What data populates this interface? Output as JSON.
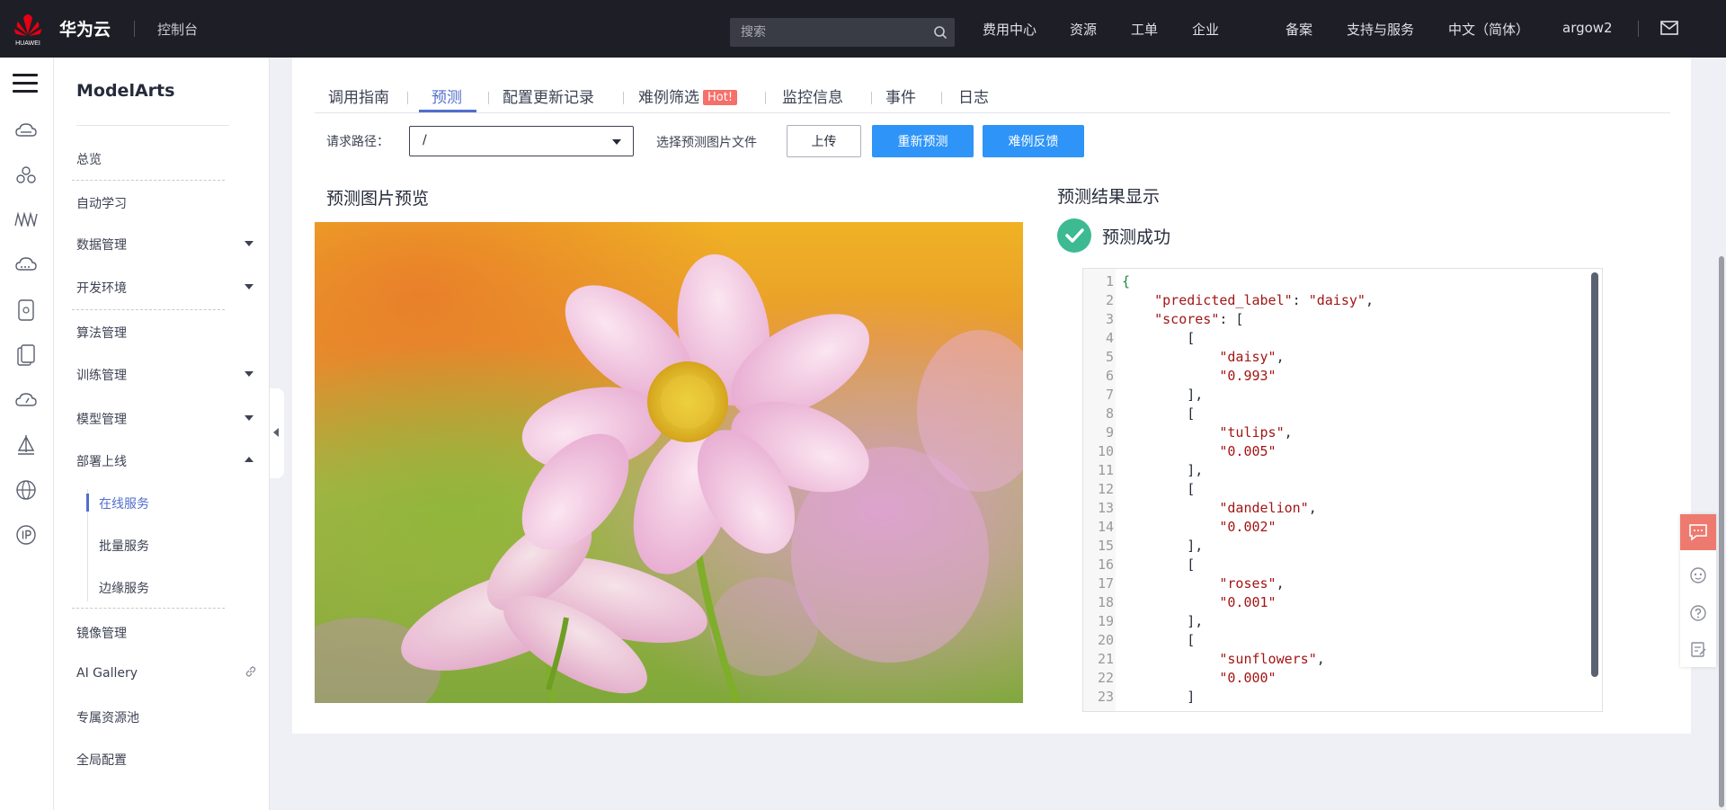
{
  "brand": {
    "logo_label": "HUAWEI",
    "name": "华为云",
    "console": "控制台"
  },
  "search": {
    "placeholder": "搜索"
  },
  "top_nav": [
    "费用中心",
    "资源",
    "工单",
    "企业",
    "备案",
    "支持与服务",
    "中文（简体）",
    "argow2"
  ],
  "sidebar": {
    "title": "ModelArts",
    "items": [
      "总览",
      "自动学习",
      "数据管理",
      "开发环境",
      "算法管理",
      "训练管理",
      "模型管理",
      "部署上线"
    ],
    "sub_items": [
      "在线服务",
      "批量服务",
      "边缘服务"
    ],
    "items_after": [
      "镜像管理",
      "AI Gallery",
      "专属资源池",
      "全局配置"
    ]
  },
  "tabs": [
    "调用指南",
    "预测",
    "配置更新记录",
    "难例筛选",
    "监控信息",
    "事件",
    "日志"
  ],
  "hot_badge": "Hot!",
  "request": {
    "label": "请求路径：",
    "path_value": "/",
    "file_label": "选择预测图片文件",
    "upload_button": "上传",
    "repredict_button": "重新预测",
    "feedback_button": "难例反馈"
  },
  "preview": {
    "title": "预测图片预览"
  },
  "result": {
    "title": "预测结果显示",
    "status": "预测成功",
    "predicted_label": "daisy",
    "scores": [
      [
        "daisy",
        "0.993"
      ],
      [
        "tulips",
        "0.005"
      ],
      [
        "dandelion",
        "0.002"
      ],
      [
        "roses",
        "0.001"
      ],
      [
        "sunflowers",
        "0.000"
      ]
    ],
    "code_lines": [
      "{",
      "    \"predicted_label\": \"daisy\",",
      "    \"scores\": [",
      "        [",
      "            \"daisy\",",
      "            \"0.993\"",
      "        ],",
      "        [",
      "            \"tulips\",",
      "            \"0.005\"",
      "        ],",
      "        [",
      "            \"dandelion\",",
      "            \"0.002\"",
      "        ],",
      "        [",
      "            \"roses\",",
      "            \"0.001\"",
      "        ],",
      "        [",
      "            \"sunflowers\",",
      "            \"0.000\"",
      "        ]"
    ]
  },
  "colors": {
    "accent": "#526ecc",
    "primary_button": "#2e94f8",
    "success": "#3dba92",
    "hot": "#f66f6a",
    "topbar": "#1e1e26"
  },
  "icons": [
    "huawei-logo",
    "search-icon",
    "mail-icon",
    "menu-icon",
    "cloud-icon",
    "nodes-icon",
    "wave-icon",
    "chat-icon",
    "help-icon",
    "edit-icon"
  ]
}
